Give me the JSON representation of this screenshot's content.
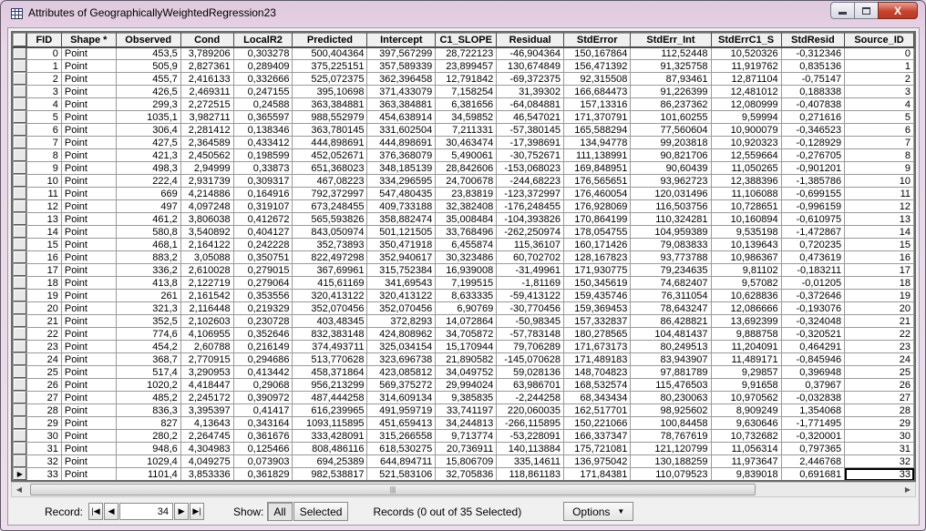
{
  "window": {
    "title": "Attributes of GeographicallyWeightedRegression23",
    "controls": {
      "minimize": "—",
      "maximize": "□",
      "close": "X"
    }
  },
  "table": {
    "columns": [
      "FID",
      "Shape *",
      "Observed",
      "Cond",
      "LocalR2",
      "Predicted",
      "Intercept",
      "C1_SLOPE",
      "Residual",
      "StdError",
      "StdErr_Int",
      "StdErrC1_S",
      "StdResid",
      "Source_ID"
    ],
    "rows": [
      [
        "0",
        "Point",
        "453,5",
        "3,789206",
        "0,303278",
        "500,404364",
        "397,567299",
        "28,722123",
        "-46,904364",
        "150,167864",
        "112,52448",
        "10,520326",
        "-0,312346",
        "0"
      ],
      [
        "1",
        "Point",
        "505,9",
        "2,827361",
        "0,289409",
        "375,225151",
        "357,589339",
        "23,899457",
        "130,674849",
        "156,471392",
        "91,325758",
        "11,919762",
        "0,835136",
        "1"
      ],
      [
        "2",
        "Point",
        "455,7",
        "2,416133",
        "0,332666",
        "525,072375",
        "362,396458",
        "12,791842",
        "-69,372375",
        "92,315508",
        "87,93461",
        "12,871104",
        "-0,75147",
        "2"
      ],
      [
        "3",
        "Point",
        "426,5",
        "2,469311",
        "0,247155",
        "395,10698",
        "371,433079",
        "7,158254",
        "31,39302",
        "166,684473",
        "91,226399",
        "12,481012",
        "0,188338",
        "3"
      ],
      [
        "4",
        "Point",
        "299,3",
        "2,272515",
        "0,24588",
        "363,384881",
        "363,384881",
        "6,381656",
        "-64,084881",
        "157,13316",
        "86,237362",
        "12,080999",
        "-0,407838",
        "4"
      ],
      [
        "5",
        "Point",
        "1035,1",
        "3,982711",
        "0,365597",
        "988,552979",
        "454,638914",
        "34,59852",
        "46,547021",
        "171,370791",
        "101,60255",
        "9,59994",
        "0,271616",
        "5"
      ],
      [
        "6",
        "Point",
        "306,4",
        "2,281412",
        "0,138346",
        "363,780145",
        "331,602504",
        "7,211331",
        "-57,380145",
        "165,588294",
        "77,560604",
        "10,900079",
        "-0,346523",
        "6"
      ],
      [
        "7",
        "Point",
        "427,5",
        "2,364589",
        "0,433412",
        "444,898691",
        "444,898691",
        "30,463474",
        "-17,398691",
        "134,94778",
        "99,203818",
        "10,920323",
        "-0,128929",
        "7"
      ],
      [
        "8",
        "Point",
        "421,3",
        "2,450562",
        "0,198599",
        "452,052671",
        "376,368079",
        "5,490061",
        "-30,752671",
        "111,138991",
        "90,821706",
        "12,559664",
        "-0,276705",
        "8"
      ],
      [
        "9",
        "Point",
        "498,3",
        "2,94999",
        "0,33873",
        "651,368023",
        "348,185139",
        "28,842606",
        "-153,068023",
        "169,848951",
        "90,60439",
        "11,050265",
        "-0,901201",
        "9"
      ],
      [
        "10",
        "Point",
        "222,4",
        "2,931739",
        "0,309317",
        "467,08223",
        "334,296595",
        "24,700678",
        "-244,68223",
        "176,565651",
        "93,962723",
        "12,388396",
        "-1,385786",
        "10"
      ],
      [
        "11",
        "Point",
        "669",
        "4,214886",
        "0,164916",
        "792,372997",
        "547,480435",
        "23,83819",
        "-123,372997",
        "176,460054",
        "120,031496",
        "11,106088",
        "-0,699155",
        "11"
      ],
      [
        "12",
        "Point",
        "497",
        "4,097248",
        "0,319107",
        "673,248455",
        "409,733188",
        "32,382408",
        "-176,248455",
        "176,928069",
        "116,503756",
        "10,728651",
        "-0,996159",
        "12"
      ],
      [
        "13",
        "Point",
        "461,2",
        "3,806038",
        "0,412672",
        "565,593826",
        "358,882474",
        "35,008484",
        "-104,393826",
        "170,864199",
        "110,324281",
        "10,160894",
        "-0,610975",
        "13"
      ],
      [
        "14",
        "Point",
        "580,8",
        "3,540892",
        "0,404127",
        "843,050974",
        "501,121505",
        "33,768496",
        "-262,250974",
        "178,054755",
        "104,959389",
        "9,535198",
        "-1,472867",
        "14"
      ],
      [
        "15",
        "Point",
        "468,1",
        "2,164122",
        "0,242228",
        "352,73893",
        "350,471918",
        "6,455874",
        "115,36107",
        "160,171426",
        "79,083833",
        "10,139643",
        "0,720235",
        "15"
      ],
      [
        "16",
        "Point",
        "883,2",
        "3,05088",
        "0,350751",
        "822,497298",
        "352,940617",
        "30,323486",
        "60,702702",
        "128,167823",
        "93,773788",
        "10,986367",
        "0,473619",
        "16"
      ],
      [
        "17",
        "Point",
        "336,2",
        "2,610028",
        "0,279015",
        "367,69961",
        "315,752384",
        "16,939008",
        "-31,49961",
        "171,930775",
        "79,234635",
        "9,81102",
        "-0,183211",
        "17"
      ],
      [
        "18",
        "Point",
        "413,8",
        "2,122719",
        "0,279064",
        "415,61169",
        "341,69543",
        "7,199515",
        "-1,81169",
        "150,345619",
        "74,682407",
        "9,57082",
        "-0,01205",
        "18"
      ],
      [
        "19",
        "Point",
        "261",
        "2,161542",
        "0,353556",
        "320,413122",
        "320,413122",
        "8,633335",
        "-59,413122",
        "159,435746",
        "76,311054",
        "10,628836",
        "-0,372646",
        "19"
      ],
      [
        "20",
        "Point",
        "321,3",
        "2,116448",
        "0,219329",
        "352,070456",
        "352,070456",
        "6,90769",
        "-30,770456",
        "159,369453",
        "78,643247",
        "12,086666",
        "-0,193076",
        "20"
      ],
      [
        "21",
        "Point",
        "352,5",
        "2,102603",
        "0,230728",
        "403,48345",
        "372,8293",
        "14,072864",
        "-50,98345",
        "157,332837",
        "86,428821",
        "13,692399",
        "-0,324048",
        "21"
      ],
      [
        "22",
        "Point",
        "774,6",
        "4,106955",
        "0,352646",
        "832,383148",
        "424,808962",
        "34,705872",
        "-57,783148",
        "180,278565",
        "104,481437",
        "9,888758",
        "-0,320521",
        "22"
      ],
      [
        "23",
        "Point",
        "454,2",
        "2,60788",
        "0,216149",
        "374,493711",
        "325,034154",
        "15,170944",
        "79,706289",
        "171,673173",
        "80,249513",
        "11,204091",
        "0,464291",
        "23"
      ],
      [
        "24",
        "Point",
        "368,7",
        "2,770915",
        "0,294686",
        "513,770628",
        "323,696738",
        "21,890582",
        "-145,070628",
        "171,489183",
        "83,943907",
        "11,489171",
        "-0,845946",
        "24"
      ],
      [
        "25",
        "Point",
        "517,4",
        "3,290953",
        "0,413442",
        "458,371864",
        "423,085812",
        "34,049752",
        "59,028136",
        "148,704823",
        "97,881789",
        "9,29857",
        "0,396948",
        "25"
      ],
      [
        "26",
        "Point",
        "1020,2",
        "4,418447",
        "0,29068",
        "956,213299",
        "569,375272",
        "29,994024",
        "63,986701",
        "168,532574",
        "115,476503",
        "9,91658",
        "0,37967",
        "26"
      ],
      [
        "27",
        "Point",
        "485,2",
        "2,245172",
        "0,390972",
        "487,444258",
        "314,609134",
        "9,385835",
        "-2,244258",
        "68,343434",
        "80,230063",
        "10,970562",
        "-0,032838",
        "27"
      ],
      [
        "28",
        "Point",
        "836,3",
        "3,395397",
        "0,41417",
        "616,239965",
        "491,959719",
        "33,741197",
        "220,060035",
        "162,517701",
        "98,925602",
        "8,909249",
        "1,354068",
        "28"
      ],
      [
        "29",
        "Point",
        "827",
        "4,13643",
        "0,343164",
        "1093,115895",
        "451,659413",
        "34,244813",
        "-266,115895",
        "150,221066",
        "100,84458",
        "9,630646",
        "-1,771495",
        "29"
      ],
      [
        "30",
        "Point",
        "280,2",
        "2,264745",
        "0,361676",
        "333,428091",
        "315,266558",
        "9,713774",
        "-53,228091",
        "166,337347",
        "78,767619",
        "10,732682",
        "-0,320001",
        "30"
      ],
      [
        "31",
        "Point",
        "948,6",
        "4,304983",
        "0,125466",
        "808,486116",
        "618,530275",
        "20,736911",
        "140,113884",
        "175,721081",
        "121,120799",
        "11,056314",
        "0,797365",
        "31"
      ],
      [
        "32",
        "Point",
        "1029,4",
        "4,049275",
        "0,073903",
        "694,25389",
        "644,894711",
        "15,806709",
        "335,14611",
        "136,975042",
        "130,188259",
        "11,973647",
        "2,446768",
        "32"
      ],
      [
        "33",
        "Point",
        "1101,4",
        "3,853336",
        "0,361829",
        "982,538817",
        "521,583106",
        "32,705836",
        "118,861183",
        "171,84381",
        "110,079523",
        "9,839018",
        "0,691681",
        "33"
      ]
    ],
    "current_row_index": 33,
    "current_row_marker": "▶"
  },
  "statusbar": {
    "record_label": "Record:",
    "record_value": "34",
    "show_label": "Show:",
    "all_label": "All",
    "selected_label": "Selected",
    "records_summary": "Records (0 out of 35 Selected)",
    "options_label": "Options"
  },
  "scrollbar": {
    "thumb_grip": "|||"
  }
}
